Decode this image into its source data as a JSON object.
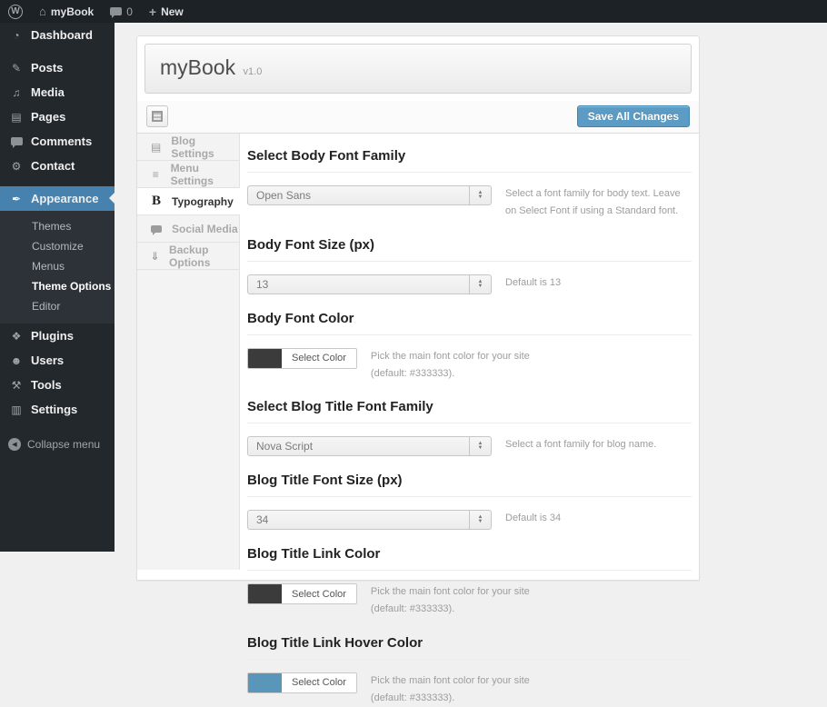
{
  "admin_bar": {
    "site_name": "myBook",
    "comment_count": "0",
    "new_label": "New"
  },
  "sidebar": {
    "items": [
      {
        "name": "dashboard",
        "label": "Dashboard",
        "glyph": "◔",
        "gap": false
      },
      {
        "name": "posts",
        "label": "Posts",
        "glyph": "✎",
        "gap": true
      },
      {
        "name": "media",
        "label": "Media",
        "glyph": "♫",
        "gap": false
      },
      {
        "name": "pages",
        "label": "Pages",
        "glyph": "▤",
        "gap": false
      },
      {
        "name": "comments",
        "label": "Comments",
        "glyph": "bubble",
        "gap": false
      },
      {
        "name": "contact",
        "label": "Contact",
        "glyph": "⚙",
        "gap": false
      },
      {
        "name": "appearance",
        "label": "Appearance",
        "glyph": "✒",
        "gap": true,
        "active": true,
        "submenu": [
          {
            "label": "Themes",
            "current": false
          },
          {
            "label": "Customize",
            "current": false
          },
          {
            "label": "Menus",
            "current": false
          },
          {
            "label": "Theme Options",
            "current": true
          },
          {
            "label": "Editor",
            "current": false
          }
        ]
      },
      {
        "name": "plugins",
        "label": "Plugins",
        "glyph": "❖",
        "gap": false
      },
      {
        "name": "users",
        "label": "Users",
        "glyph": "☻",
        "gap": false
      },
      {
        "name": "tools",
        "label": "Tools",
        "glyph": "⚒",
        "gap": false
      },
      {
        "name": "settings",
        "label": "Settings",
        "glyph": "▥",
        "gap": false
      }
    ],
    "collapse_label": "Collapse menu"
  },
  "panel": {
    "title": "myBook",
    "version": "v1.0",
    "toolbar": {
      "save_label": "Save All Changes"
    },
    "tabs": [
      {
        "name": "blog-settings",
        "label": "Blog Settings",
        "glyph": "▤",
        "active": false
      },
      {
        "name": "menu-settings",
        "label": "Menu Settings",
        "glyph": "≡",
        "active": false
      },
      {
        "name": "typography",
        "label": "Typography",
        "glyph": "B",
        "active": true
      },
      {
        "name": "social-media",
        "label": "Social Media",
        "glyph": "bubble",
        "active": false
      },
      {
        "name": "backup-options",
        "label": "Backup Options",
        "glyph": "⇓",
        "active": false
      }
    ],
    "sections": [
      {
        "heading": "Select Body Font Family",
        "type": "select",
        "value": "Open Sans",
        "help": "Select a font family for body text. Leave on Select Font if using a Standard font."
      },
      {
        "heading": "Body Font Size (px)",
        "type": "select",
        "value": "13",
        "help": "Default is 13"
      },
      {
        "heading": "Body Font Color",
        "type": "color",
        "swatch": "#3b3b3b",
        "button_label": "Select Color",
        "help": "Pick the main font color for your site (default: #333333)."
      },
      {
        "heading": "Select Blog Title Font Family",
        "type": "select",
        "value": "Nova Script",
        "help": "Select a font family for blog name."
      },
      {
        "heading": "Blog Title Font Size (px)",
        "type": "select",
        "value": "34",
        "help": "Default is 34"
      },
      {
        "heading": "Blog Title Link Color",
        "type": "color",
        "swatch": "#3b3b3b",
        "button_label": "Select Color",
        "help": "Pick the main font color for your site (default: #333333)."
      },
      {
        "heading": "Blog Title Link Hover Color",
        "type": "color",
        "swatch": "#5a96ba",
        "button_label": "Select Color",
        "help": "Pick the main font color for your site (default: #333333)."
      }
    ]
  },
  "colors": {
    "accent_blue": "#4682ad",
    "save_button_blue": "#5b9bc4",
    "default_font_color": "#333333"
  }
}
